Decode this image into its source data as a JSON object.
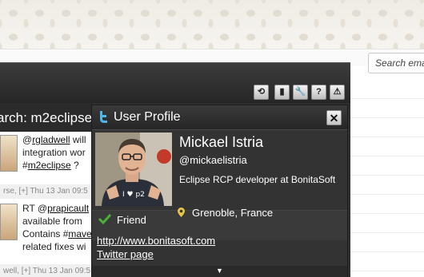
{
  "background": {
    "search_placeholder": "Search ema"
  },
  "toolbar": {
    "buttons": [
      {
        "icon": "refresh-icon",
        "glyph": "⟲"
      },
      {
        "icon": "pause-icon",
        "glyph": "▮"
      },
      {
        "icon": "wrench-icon",
        "glyph": "🔧"
      },
      {
        "icon": "help-icon",
        "glyph": "?"
      },
      {
        "icon": "warning-icon",
        "glyph": "⚠"
      }
    ]
  },
  "timeline": {
    "title": "arch: m2eclipse",
    "tweets": [
      {
        "line1_prefix": "@",
        "line1_user": "rgladwell",
        "line1_suffix": " will",
        "line2": "integration wor",
        "line3_prefix": "#",
        "line3_tag": "m2eclipse",
        "line3_suffix": " ?",
        "meta": "rse, [+] Thu 13 Jan 09:5"
      },
      {
        "line1_prefix": "RT @",
        "line1_user": "prapicault",
        "line2": "available from",
        "line3_prefix": "Contains #",
        "line3_tag": "mave",
        "line4": "related fixes wi",
        "meta": "well, [+] Thu 13 Jan 09:5"
      }
    ]
  },
  "profile": {
    "title": "User Profile",
    "close_label": "✕",
    "name": "Mickael Istria",
    "handle": "@mickaelistria",
    "bio": "Eclipse RCP developer at BonitaSoft",
    "friend_label": "Friend",
    "location": "Grenoble, France",
    "website": "http://www.bonitasoft.com",
    "twitter_page": "Twitter page",
    "more_indicator": "▼",
    "photo_shirt_text": "I ♥ p2"
  },
  "colors": {
    "panel_bg": "#333333",
    "check_green": "#4caf3a",
    "pin_yellow": "#e8c547"
  }
}
